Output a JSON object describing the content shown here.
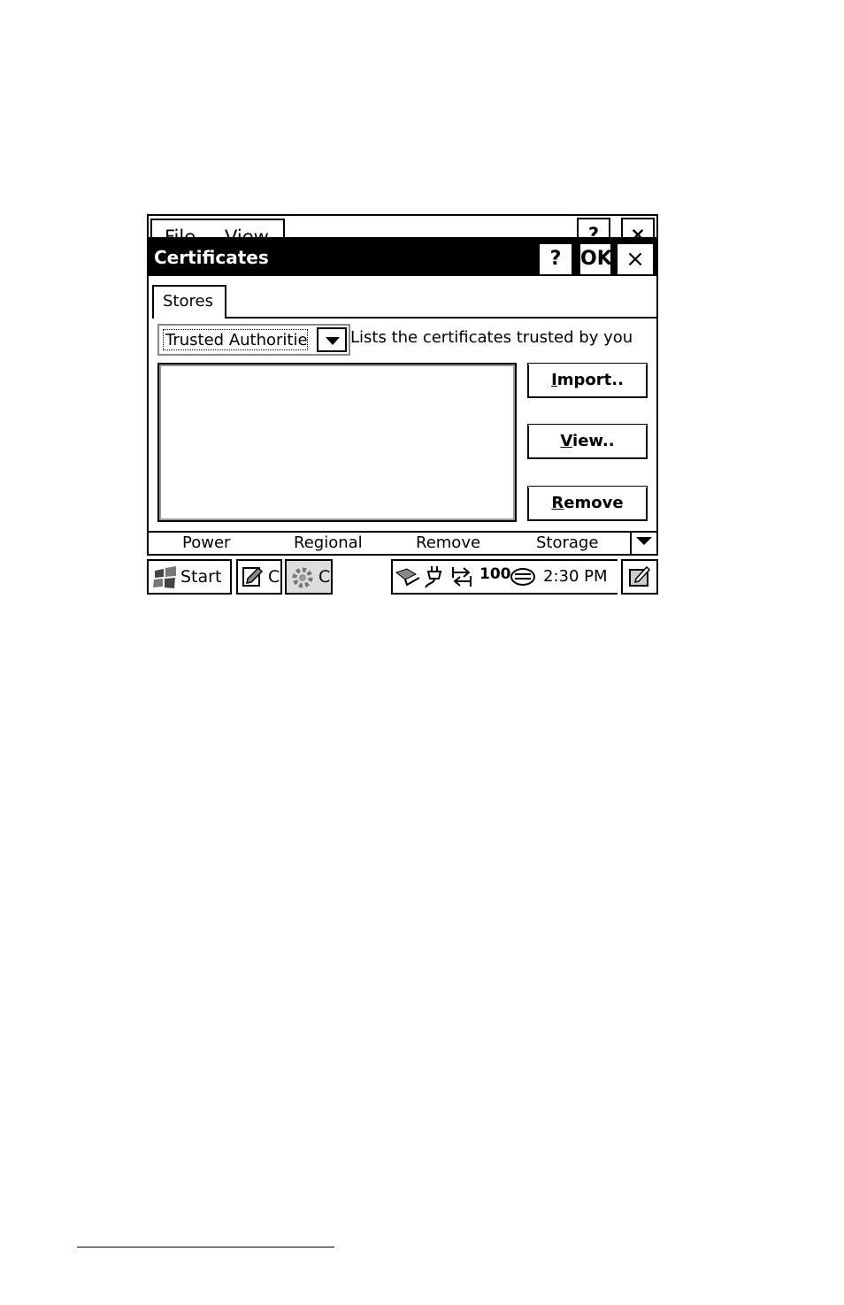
{
  "background_window": {
    "menu": [
      "File",
      "View"
    ],
    "help_label": "?",
    "close_label": "×"
  },
  "dialog": {
    "title": "Certificates",
    "help_label": "?",
    "ok_label": "OK",
    "close_label": "×",
    "tab": "Stores",
    "store_select": {
      "selected": "Trusted Authorities"
    },
    "description": "Lists the certificates trusted by you",
    "buttons": {
      "import": {
        "accel": "I",
        "rest": "mport.."
      },
      "view": {
        "accel": "V",
        "rest": "iew.."
      },
      "remove": {
        "accel": "R",
        "rest": "emove"
      }
    }
  },
  "control_panel_bar": {
    "items": [
      "Power",
      "Regional",
      "Remove",
      "Storage"
    ]
  },
  "taskbar": {
    "start_label": "Start",
    "task1_label": "C",
    "task2_label": "C",
    "battery_label": "100",
    "time": "2:30 PM"
  }
}
